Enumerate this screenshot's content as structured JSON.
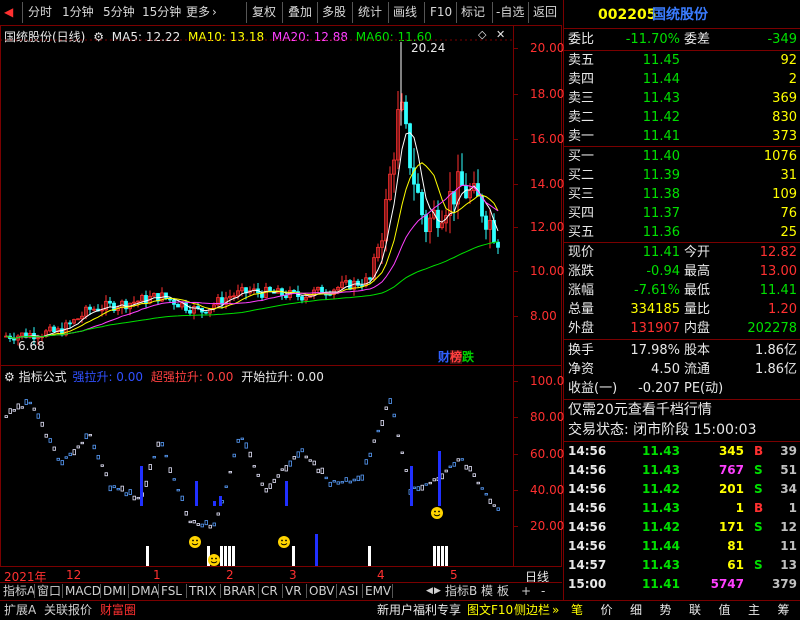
{
  "toolbar": {
    "tabs": [
      "分时",
      "1分钟",
      "5分钟",
      "15分钟",
      "更多"
    ],
    "more_arrow": "›",
    "buttons": [
      "复权",
      "叠加",
      "多股",
      "统计",
      "画线",
      "F10",
      "标记",
      "-自选",
      "返回"
    ]
  },
  "main_chart": {
    "title": "国统股份(日线)",
    "ma5": "MA5: 12.22",
    "ma10": "MA10: 13.18",
    "ma20": "MA20: 12.88",
    "ma60": "MA60: 11.60",
    "y_ticks": [
      "20.00",
      "18.00",
      "16.00",
      "14.00",
      "12.00",
      "10.00",
      "8.00"
    ],
    "high_label": "20.24",
    "low_label": "6.68",
    "badges": [
      "财",
      "榜",
      "跌"
    ],
    "badge_colors": [
      "#3060ff",
      "#ff4040",
      "#00d000"
    ]
  },
  "indicator": {
    "name": "指标公式",
    "strong": "强拉升: 0.00",
    "super": "超强拉升: 0.00",
    "start": "开始拉升: 0.00",
    "y_ticks": [
      "100.0",
      "80.00",
      "60.00",
      "40.00",
      "20.00"
    ]
  },
  "time_axis": {
    "labels": [
      "2021年",
      "12",
      "1",
      "2",
      "3",
      "4",
      "5"
    ],
    "right": "日线"
  },
  "indicator_tabs": [
    "指标A",
    "窗口",
    "MACD",
    "DMI",
    "DMA",
    "FSL",
    "TRIX",
    "BRAR",
    "CR",
    "VR",
    "OBV",
    "ASI",
    "EMV"
  ],
  "indicator_tabs_right": [
    "指标B",
    "模",
    "板",
    "+",
    "-"
  ],
  "bottom_left": [
    "扩展A",
    "关联报价",
    "财富圈"
  ],
  "bottom_mid": [
    "新用户福利专享",
    "图文F10",
    "侧边栏"
  ],
  "bottom_right_tabs": [
    "笔",
    "价",
    "细",
    "势",
    "联",
    "值",
    "主",
    "筹"
  ],
  "quote": {
    "code": "002205",
    "name": "国统股份",
    "weibi_label": "委比",
    "weibi": "-11.70%",
    "weicha_label": "委差",
    "weicha": "-349",
    "sells": [
      {
        "label": "卖五",
        "price": "11.45",
        "vol": "92"
      },
      {
        "label": "卖四",
        "price": "11.44",
        "vol": "2"
      },
      {
        "label": "卖三",
        "price": "11.43",
        "vol": "369"
      },
      {
        "label": "卖二",
        "price": "11.42",
        "vol": "830"
      },
      {
        "label": "卖一",
        "price": "11.41",
        "vol": "373"
      }
    ],
    "buys": [
      {
        "label": "买一",
        "price": "11.40",
        "vol": "1076"
      },
      {
        "label": "买二",
        "price": "11.39",
        "vol": "31"
      },
      {
        "label": "买三",
        "price": "11.38",
        "vol": "109"
      },
      {
        "label": "买四",
        "price": "11.37",
        "vol": "76"
      },
      {
        "label": "买五",
        "price": "11.36",
        "vol": "25"
      }
    ],
    "stats": [
      {
        "l1": "现价",
        "v1": "11.41",
        "c1": "#00e000",
        "l2": "今开",
        "v2": "12.82",
        "c2": "#ff3030"
      },
      {
        "l1": "涨跌",
        "v1": "-0.94",
        "c1": "#00e000",
        "l2": "最高",
        "v2": "13.00",
        "c2": "#ff3030"
      },
      {
        "l1": "涨幅",
        "v1": "-7.61%",
        "c1": "#00e000",
        "l2": "最低",
        "v2": "11.41",
        "c2": "#00e000"
      },
      {
        "l1": "总量",
        "v1": "334185",
        "c1": "#ffff00",
        "l2": "量比",
        "v2": "1.20",
        "c2": "#ff3030"
      },
      {
        "l1": "外盘",
        "v1": "131907",
        "c1": "#ff3030",
        "l2": "内盘",
        "v2": "202278",
        "c2": "#00e000"
      }
    ],
    "stats2": [
      {
        "l1": "换手",
        "v1": "17.98%",
        "l2": "股本",
        "v2": "1.86亿"
      },
      {
        "l1": "净资",
        "v1": "4.50",
        "l2": "流通",
        "v2": "1.86亿"
      },
      {
        "l1": "收益(一)",
        "v1": "-0.207",
        "l2": "PE(动)",
        "v2": ""
      }
    ],
    "promo": "仅需20元查看千档行情",
    "status": "交易状态: 闭市阶段 15:00:03",
    "ticks": [
      {
        "t": "14:56",
        "p": "11.43",
        "v": "345",
        "vc": "#ffff00",
        "d": "B",
        "dc": "#ff3030",
        "n": "39"
      },
      {
        "t": "14:56",
        "p": "11.43",
        "v": "767",
        "vc": "#ff40ff",
        "d": "S",
        "dc": "#00e000",
        "n": "51"
      },
      {
        "t": "14:56",
        "p": "11.42",
        "v": "201",
        "vc": "#ffff00",
        "d": "S",
        "dc": "#00e000",
        "n": "34"
      },
      {
        "t": "14:56",
        "p": "11.43",
        "v": "1",
        "vc": "#ffff00",
        "d": "B",
        "dc": "#ff3030",
        "n": "1"
      },
      {
        "t": "14:56",
        "p": "11.42",
        "v": "171",
        "vc": "#ffff00",
        "d": "S",
        "dc": "#00e000",
        "n": "12"
      },
      {
        "t": "14:56",
        "p": "11.44",
        "v": "81",
        "vc": "#ffff00",
        "d": "",
        "dc": "#00e000",
        "n": "11"
      },
      {
        "t": "14:57",
        "p": "11.43",
        "v": "61",
        "vc": "#ffff00",
        "d": "S",
        "dc": "#00e000",
        "n": "13"
      },
      {
        "t": "15:00",
        "p": "11.41",
        "v": "5747",
        "vc": "#ff40ff",
        "d": "",
        "dc": "#00e000",
        "n": "379"
      }
    ]
  }
}
